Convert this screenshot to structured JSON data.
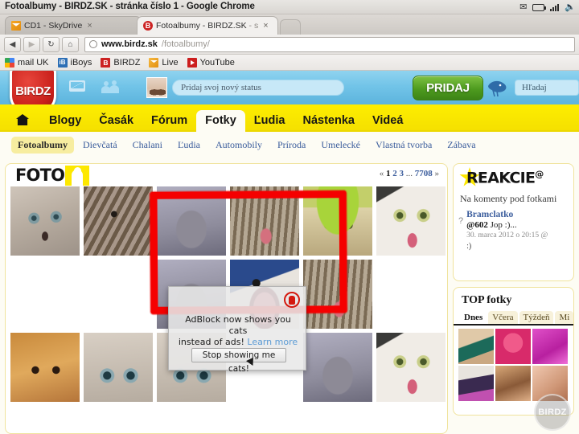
{
  "window": {
    "title": "Fotoalbumy - BIRDZ.SK - stránka číslo 1 - Google Chrome",
    "tray": [
      "mail-icon",
      "battery-icon",
      "signal-icon",
      "volume-icon"
    ]
  },
  "tabs": [
    {
      "title": "CD1 - SkyDrive",
      "favicon": "skydrive-icon",
      "active": false,
      "close": "×"
    },
    {
      "title": "Fotoalbumy - BIRDZ.SK",
      "title_dim": " - s",
      "favicon": "birdz-icon",
      "active": true,
      "close": "×"
    }
  ],
  "toolbar": {
    "back": "◀",
    "forward": "▶",
    "reload": "↻",
    "home": "⌂",
    "url_bold": "www.birdz.sk",
    "url_dim": "/fotoalbumy/"
  },
  "bookmarks": [
    {
      "label": "mail UK",
      "icon": "gmail-icon"
    },
    {
      "label": "iBoys",
      "icon": "iboys-icon",
      "glyph": "iB"
    },
    {
      "label": "BIRDZ",
      "icon": "birdz-icon",
      "glyph": "B"
    },
    {
      "label": "Live",
      "icon": "live-mail-icon"
    },
    {
      "label": "YouTube",
      "icon": "youtube-icon"
    }
  ],
  "site_header": {
    "logo": "BIRDZ",
    "mail_icon": "envelope-icon",
    "friends_icon": "people-icon",
    "avatar": "user-avatar",
    "status_placeholder": "Pridaj svoj nový status",
    "pridaj_button": "PRIDAJ",
    "bird_icon": "bird-icon",
    "search_placeholder": "Hľadaj"
  },
  "main_nav": {
    "home_icon": "home-icon",
    "items": [
      {
        "label": "Blogy",
        "active": false
      },
      {
        "label": "Časák",
        "active": false
      },
      {
        "label": "Fórum",
        "active": false
      },
      {
        "label": "Fotky",
        "active": true
      },
      {
        "label": "Ľudia",
        "active": false
      },
      {
        "label": "Nástenka",
        "active": false
      },
      {
        "label": "Videá",
        "active": false
      }
    ]
  },
  "sub_nav": [
    {
      "label": "Fotoalbumy",
      "active": true
    },
    {
      "label": "Dievčatá",
      "active": false
    },
    {
      "label": "Chalani",
      "active": false
    },
    {
      "label": "Ľudia",
      "active": false
    },
    {
      "label": "Automobily",
      "active": false
    },
    {
      "label": "Príroda",
      "active": false
    },
    {
      "label": "Umelecké",
      "active": false
    },
    {
      "label": "Vlastná tvorba",
      "active": false
    },
    {
      "label": "Zábava",
      "active": false
    }
  ],
  "foto_panel": {
    "title": "FOTO",
    "badge_icon": "person-badge-icon",
    "pager": {
      "prev": "«",
      "pages": [
        "1",
        "2",
        "3"
      ],
      "ellipsis": "...",
      "last": "7708",
      "next": "»"
    }
  },
  "adblock_popup": {
    "line1": "AdBlock now shows you cats",
    "line2": "instead of ads!",
    "link": "Learn more",
    "button": "Stop showing me cats!",
    "logo_icon": "adblock-icon"
  },
  "annotation": {
    "shape": "red-rectangle-marker",
    "color": "#f50000"
  },
  "sidebar": {
    "reakcie": {
      "title": "REAKCIE",
      "title_sup": "@",
      "star_icon": "star-icon",
      "subtitle": "Na komenty pod fotkami",
      "question_mark": "?",
      "item": {
        "user": "Bramclatko",
        "mention": "@602",
        "text": "Jop :)...",
        "date": "30. marca 2012 o 20:15 @",
        "smiley": ":)"
      }
    },
    "top_fotky": {
      "title": "TOP fotky",
      "tabs": [
        {
          "label": "Dnes",
          "active": true
        },
        {
          "label": "Včera",
          "active": false
        },
        {
          "label": "Týždeň",
          "active": false
        },
        {
          "label": "Mi",
          "active": false
        }
      ]
    },
    "watermark": "BIRDZ"
  }
}
